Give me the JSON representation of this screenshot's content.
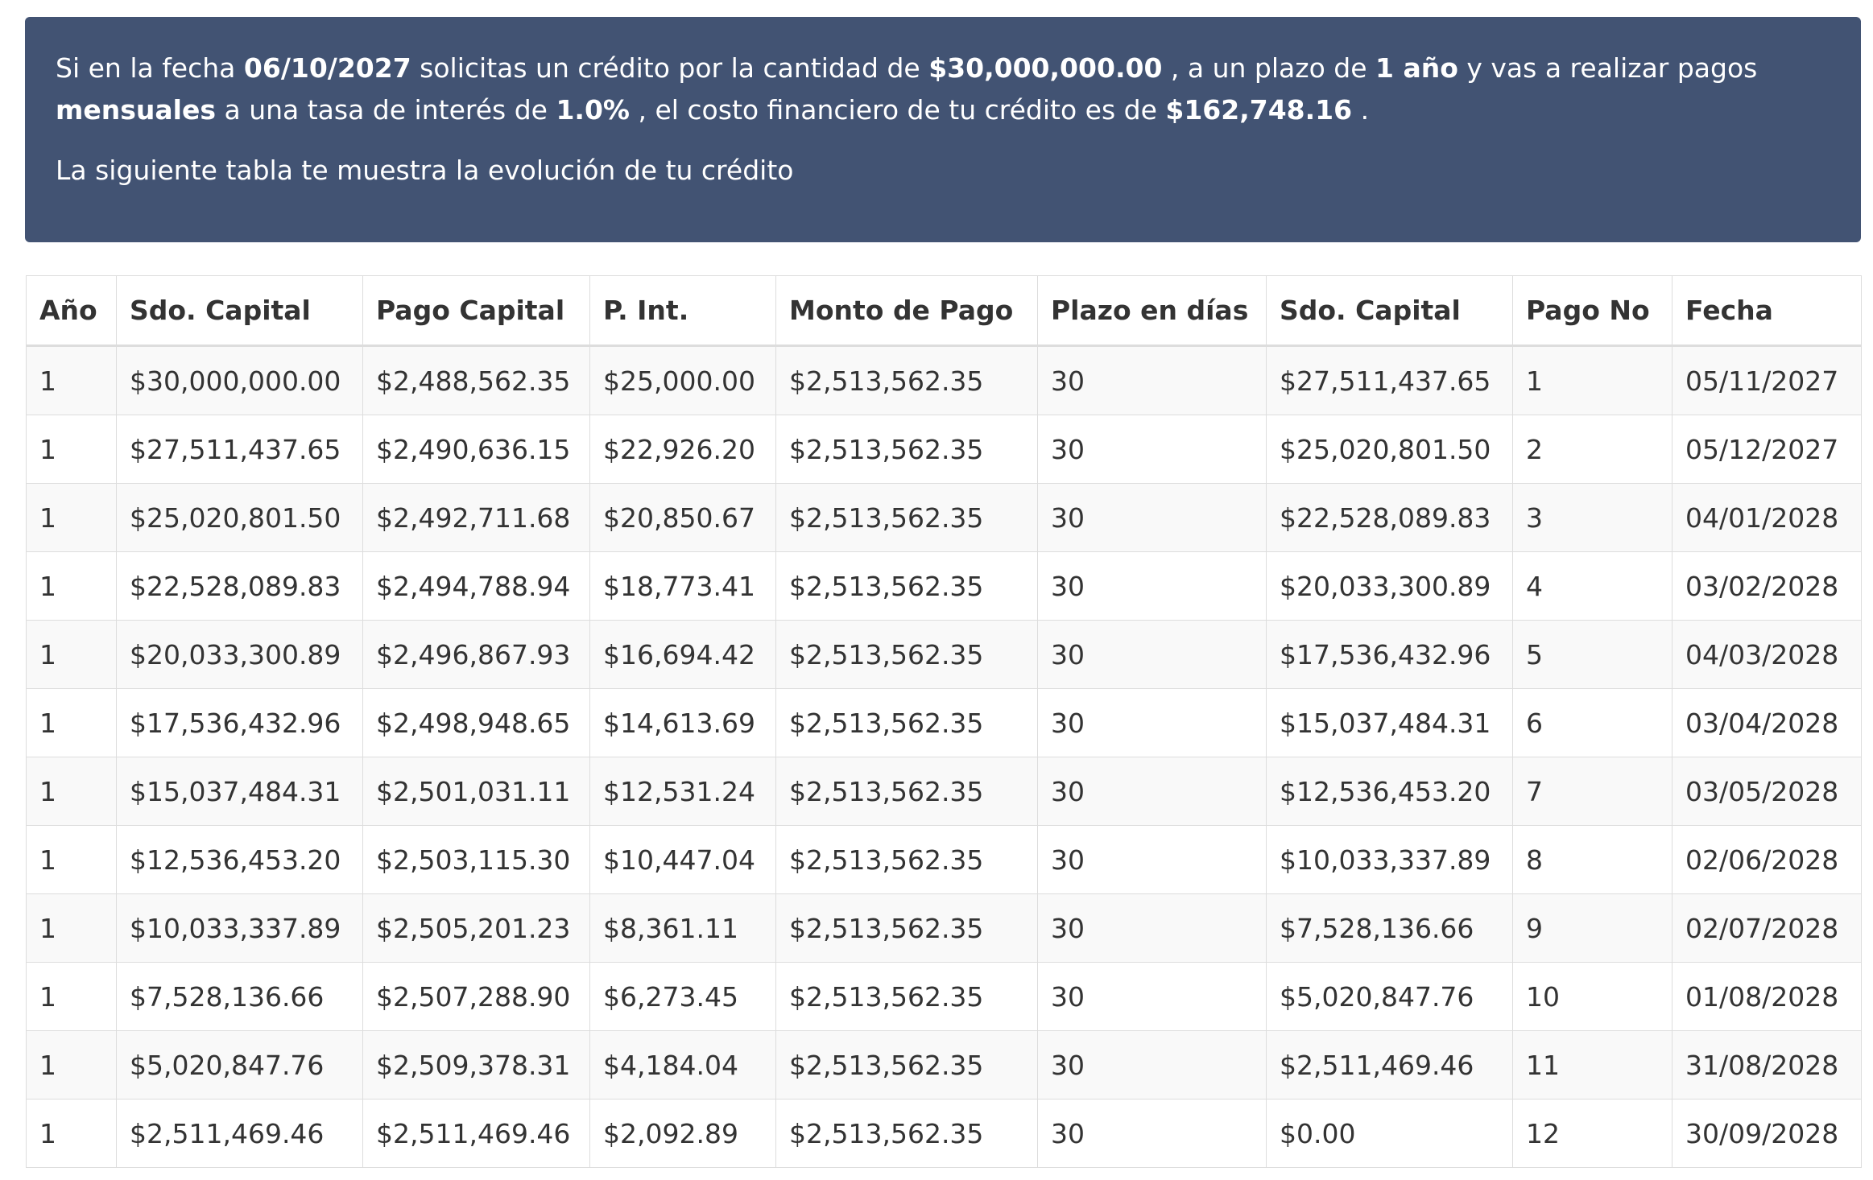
{
  "summary": {
    "s1": "Si en la fecha ",
    "fecha": "06/10/2027",
    "s2": " solicitas un crédito por la cantidad de ",
    "cantidad": "$30,000,000.00",
    "s3": " , a un plazo de ",
    "plazo": "1 año",
    "s4": " y vas a realizar pagos ",
    "frecuencia": "mensuales",
    "s5": " a una tasa de interés de ",
    "tasa": "1.0%",
    "s6": " , el costo financiero de tu crédito es de ",
    "costo": "$162,748.16",
    "s7": " .",
    "line2": "La siguiente tabla te muestra la evolución de tu crédito"
  },
  "table": {
    "headers": [
      "Año",
      "Sdo. Capital",
      "Pago Capital",
      "P. Int.",
      "Monto de Pago",
      "Plazo en días",
      "Sdo. Capital",
      "Pago No",
      "Fecha"
    ],
    "rows": [
      [
        "1",
        "$30,000,000.00",
        "$2,488,562.35",
        "$25,000.00",
        "$2,513,562.35",
        "30",
        "$27,511,437.65",
        "1",
        "05/11/2027"
      ],
      [
        "1",
        "$27,511,437.65",
        "$2,490,636.15",
        "$22,926.20",
        "$2,513,562.35",
        "30",
        "$25,020,801.50",
        "2",
        "05/12/2027"
      ],
      [
        "1",
        "$25,020,801.50",
        "$2,492,711.68",
        "$20,850.67",
        "$2,513,562.35",
        "30",
        "$22,528,089.83",
        "3",
        "04/01/2028"
      ],
      [
        "1",
        "$22,528,089.83",
        "$2,494,788.94",
        "$18,773.41",
        "$2,513,562.35",
        "30",
        "$20,033,300.89",
        "4",
        "03/02/2028"
      ],
      [
        "1",
        "$20,033,300.89",
        "$2,496,867.93",
        "$16,694.42",
        "$2,513,562.35",
        "30",
        "$17,536,432.96",
        "5",
        "04/03/2028"
      ],
      [
        "1",
        "$17,536,432.96",
        "$2,498,948.65",
        "$14,613.69",
        "$2,513,562.35",
        "30",
        "$15,037,484.31",
        "6",
        "03/04/2028"
      ],
      [
        "1",
        "$15,037,484.31",
        "$2,501,031.11",
        "$12,531.24",
        "$2,513,562.35",
        "30",
        "$12,536,453.20",
        "7",
        "03/05/2028"
      ],
      [
        "1",
        "$12,536,453.20",
        "$2,503,115.30",
        "$10,447.04",
        "$2,513,562.35",
        "30",
        "$10,033,337.89",
        "8",
        "02/06/2028"
      ],
      [
        "1",
        "$10,033,337.89",
        "$2,505,201.23",
        "$8,361.11",
        "$2,513,562.35",
        "30",
        "$7,528,136.66",
        "9",
        "02/07/2028"
      ],
      [
        "1",
        "$7,528,136.66",
        "$2,507,288.90",
        "$6,273.45",
        "$2,513,562.35",
        "30",
        "$5,020,847.76",
        "10",
        "01/08/2028"
      ],
      [
        "1",
        "$5,020,847.76",
        "$2,509,378.31",
        "$4,184.04",
        "$2,513,562.35",
        "30",
        "$2,511,469.46",
        "11",
        "31/08/2028"
      ],
      [
        "1",
        "$2,511,469.46",
        "$2,511,469.46",
        "$2,092.89",
        "$2,513,562.35",
        "30",
        "$0.00",
        "12",
        "30/09/2028"
      ]
    ]
  },
  "colors": {
    "panel_bg": "#425373",
    "panel_text": "#ffffff",
    "table_border": "#dddddd",
    "row_stripe": "#f9f9f9",
    "text": "#333333"
  }
}
